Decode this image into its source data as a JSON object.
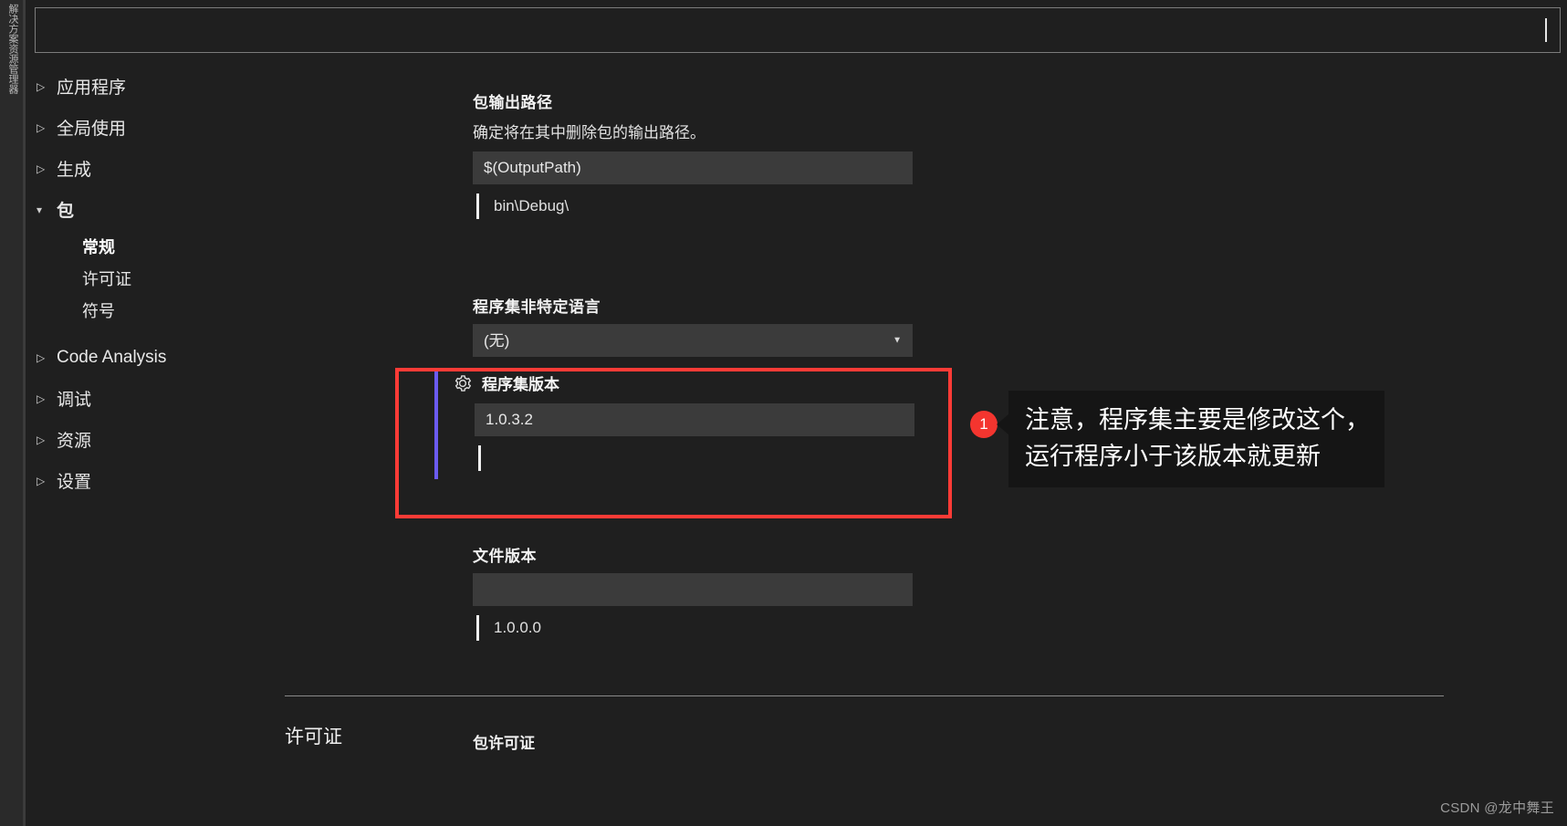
{
  "window": {
    "edge_tab_label": "解决方案资源管理器"
  },
  "search": {
    "value": "",
    "placeholder": ""
  },
  "nav": {
    "items": [
      {
        "label": "应用程序",
        "state": "collapsed",
        "icon": "triangle-right-icon",
        "level": 0
      },
      {
        "label": "全局使用",
        "state": "collapsed",
        "icon": "triangle-right-icon",
        "level": 0
      },
      {
        "label": "生成",
        "state": "collapsed",
        "icon": "triangle-right-icon",
        "level": 0
      },
      {
        "label": "包",
        "state": "expanded",
        "icon": "triangle-down-icon",
        "level": 0
      },
      {
        "label": "常规",
        "state": "selected",
        "icon": "",
        "level": 1
      },
      {
        "label": "许可证",
        "state": "normal",
        "icon": "",
        "level": 1
      },
      {
        "label": "符号",
        "state": "normal",
        "icon": "",
        "level": 1
      },
      {
        "label": "Code Analysis",
        "state": "collapsed",
        "icon": "triangle-right-icon",
        "level": 0
      },
      {
        "label": "调试",
        "state": "collapsed",
        "icon": "triangle-right-icon",
        "level": 0
      },
      {
        "label": "资源",
        "state": "collapsed",
        "icon": "triangle-right-icon",
        "level": 0
      },
      {
        "label": "设置",
        "state": "collapsed",
        "icon": "triangle-right-icon",
        "level": 0
      }
    ]
  },
  "fields": {
    "output_path": {
      "title": "包输出路径",
      "description": "确定将在其中删除包的输出路径。",
      "value": "$(OutputPath)",
      "hint": "bin\\Debug\\"
    },
    "neutral_language": {
      "title": "程序集非特定语言",
      "value": "(无)",
      "options": [
        "(无)"
      ],
      "arrow_icon": "chevron-down-icon"
    },
    "assembly_version": {
      "title": "程序集版本",
      "icon": "gear-icon",
      "value": "1.0.3.2",
      "hint": ""
    },
    "file_version": {
      "title": "文件版本",
      "value": "",
      "hint": "1.0.0.0"
    }
  },
  "license_section": {
    "heading": "许可证",
    "field_title": "包许可证"
  },
  "annotation": {
    "badge": "1",
    "line1": "注意，程序集主要是修改这个，",
    "line2": "运行程序小于该版本就更新",
    "box_color": "#ff3b36",
    "badge_color": "#f4352f"
  },
  "watermark": "CSDN @龙中舞王",
  "colors": {
    "background": "#1f1f1f",
    "input_background": "#3b3b3b",
    "accent_purple": "#6b5bf0",
    "annotation_red": "#ff3b36"
  }
}
